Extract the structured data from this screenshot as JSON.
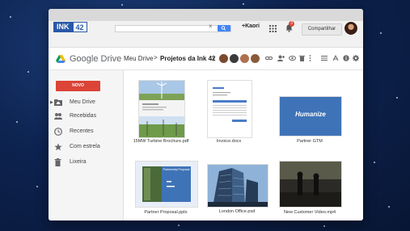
{
  "topbar": {
    "logo_main": "INK",
    "logo_num": "42",
    "search_clear": "×",
    "plus_user": "+Kaori",
    "notif_count": "3",
    "share_label": "Compartilhar"
  },
  "drive": {
    "product_name": "Google Drive",
    "breadcrumb_root": "Meu Drive",
    "breadcrumb_sep": ">",
    "breadcrumb_current": "Projetos da Ink 42",
    "caret": "▾"
  },
  "sidebar": {
    "new_label": "NOVO",
    "items": [
      {
        "label": "Meu Drive",
        "icon": "my-drive-icon"
      },
      {
        "label": "Recebidas",
        "icon": "shared-people-icon"
      },
      {
        "label": "Recentes",
        "icon": "clock-icon"
      },
      {
        "label": "Com estrela",
        "icon": "star-icon"
      },
      {
        "label": "Lixeira",
        "icon": "trash-icon"
      }
    ]
  },
  "files": [
    {
      "name": "15MW Turbine Brochure.pdf"
    },
    {
      "name": "Invoice.docx"
    },
    {
      "name": "Partner GTM",
      "thumb_text": "Humanize"
    },
    {
      "name": "Partner Proposal.pptx",
      "thumb_text": "Partnership Proposal"
    },
    {
      "name": "London Office.psd"
    },
    {
      "name": "New Customer Video.mp4"
    }
  ],
  "colors": {
    "accent_blue": "#4285f4",
    "new_red": "#db4437",
    "ink_blue": "#2a58a8"
  }
}
